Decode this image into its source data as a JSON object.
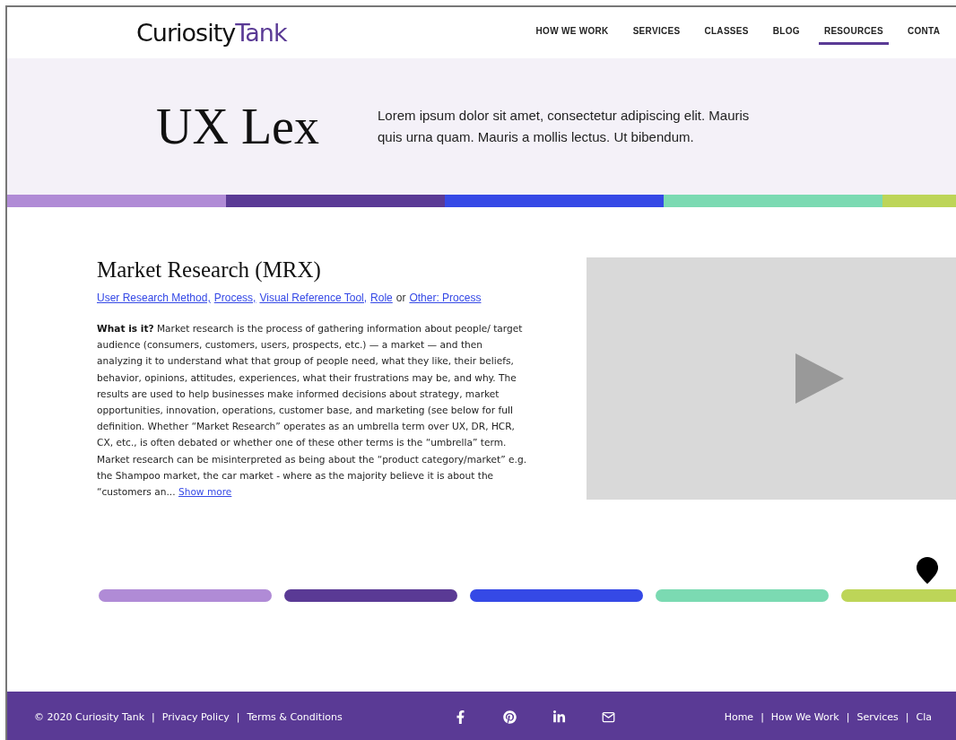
{
  "header": {
    "logo": {
      "part_1": "Curiosity",
      "part_2": "Tank"
    },
    "nav": [
      {
        "label": "HOW WE WORK",
        "selected": false
      },
      {
        "label": "SERVICES",
        "selected": false
      },
      {
        "label": "CLASSES",
        "selected": false
      },
      {
        "label": "BLOG",
        "selected": false
      },
      {
        "label": "RESOURCES",
        "selected": true
      },
      {
        "label": "CONTA",
        "selected": false
      }
    ]
  },
  "hero": {
    "title": "UX Lex",
    "description": "Lorem ipsum dolor sit amet, consectetur adipiscing elit. Mauris quis urna quam. Mauris a mollis lectus. Ut bibendum."
  },
  "stripe": [
    {
      "color": "#b08bd6"
    },
    {
      "color": "#5a3a95"
    },
    {
      "color": "#3549e6"
    },
    {
      "color": "#7bdab2"
    },
    {
      "color": "#bdd558"
    }
  ],
  "entry": {
    "title": "Market Research (MRX)",
    "categories": [
      {
        "label": "User Research Method,"
      },
      {
        "label": "Process,"
      },
      {
        "label": "Visual Reference Tool,"
      },
      {
        "label": "Role",
        "joiner": "or"
      },
      {
        "label": "Other: Process"
      }
    ],
    "lead": "What is it?",
    "body": "Market research is the process of gathering information about people/ target audience (consumers, customers, users, prospects, etc.) — a market — and then analyzing it to understand what that group of people need, what they like, their beliefs, behavior, opinions, attitudes, experiences, what their frustrations may be, and why. The results are used to help businesses make informed decisions about strategy, market opportunities, innovation, operations, customer base, and marketing (see below for full definition. Whether “Market Research” operates as an umbrella term over UX, DR, HCR, CX, etc., is often debated or whether one of these other terms is the “umbrella” term. Market research can be misinterpreted as being about the “product category/market” e.g. the Shampoo market, the car market - where as the majority believe it is about the “customers an...",
    "more_link": "Show more",
    "video": {
      "kind": "video"
    }
  },
  "timeline": [
    {
      "color": "#b08bd6",
      "selected": false
    },
    {
      "color": "#5a3a95",
      "selected": false
    },
    {
      "color": "#3549e6",
      "selected": false
    },
    {
      "color": "#7bdab2",
      "selected": false
    },
    {
      "color": "#bdd558",
      "selected": true
    }
  ],
  "footer": {
    "left_links": [
      {
        "label": "© 2020 Curiosity Tank"
      },
      {
        "label": "Privacy Policy",
        "separator": "|"
      },
      {
        "label": "Terms & Conditions",
        "separator": "|"
      }
    ],
    "social": [
      {
        "kind": "facebook"
      },
      {
        "kind": "pinterest"
      },
      {
        "kind": "linkedin"
      },
      {
        "kind": "mail"
      }
    ],
    "right_links": [
      {
        "label": "Home"
      },
      {
        "label": "How We Work",
        "separator": "|"
      },
      {
        "label": "Services",
        "separator": "|"
      },
      {
        "label": "Cla",
        "separator": "|"
      }
    ]
  }
}
